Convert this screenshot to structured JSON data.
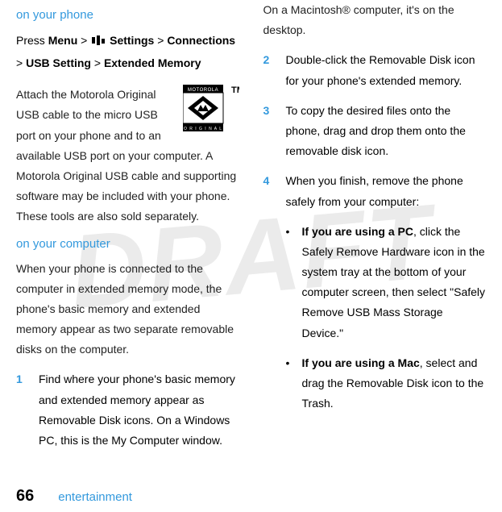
{
  "watermark": "DRAFT",
  "left": {
    "heading1": "on your phone",
    "press_prefix": "Press ",
    "press_menu": "Menu",
    "press_gt1": " > ",
    "press_settings": " Settings",
    "press_gt2": " > ",
    "press_connections": "Connections",
    "press_gt3": " > ",
    "press_usb": "USB Setting",
    "press_gt4": " > ",
    "press_ext": "Extended Memory",
    "para1": "Attach the Motorola Original USB cable to the micro USB port on your phone and to an available USB port on your computer. A Motorola Original USB cable and supporting software may be included with your phone. These tools are also sold separately.",
    "heading2": "on your computer",
    "para2": "When your phone is connected to the computer in extended memory mode, the phone's basic memory and extended memory appear as two separate removable disks on the computer.",
    "step1_num": "1",
    "step1_body": "Find where your phone's basic memory and extended memory appear as Removable Disk icons. On a Windows PC, this is the My Computer window. "
  },
  "right": {
    "step1_cont": "On a Macintosh® computer, it's on the desktop.",
    "step2_num": "2",
    "step2_body": "Double-click the Removable Disk icon for your phone's extended memory.",
    "step3_num": "3",
    "step3_body": "To copy the desired files onto the phone, drag and drop them onto the removable disk icon.",
    "step4_num": "4",
    "step4_body": "When you finish, remove the phone safely from your computer:",
    "bullet1_lead": "If you are using a PC",
    "bullet1_rest": ", click the Safely Remove Hardware icon in the system tray at the bottom of your computer screen, then select \"Safely Remove USB Mass Storage Device.\"",
    "bullet2_lead": "If you are using a Mac",
    "bullet2_rest": ", select and drag the Removable Disk icon to the Trash."
  },
  "footer": {
    "page": "66",
    "section": "entertainment"
  },
  "logo": {
    "top": "MOTOROLA",
    "bottom": "O R I G I N A L",
    "tm": "TM"
  }
}
